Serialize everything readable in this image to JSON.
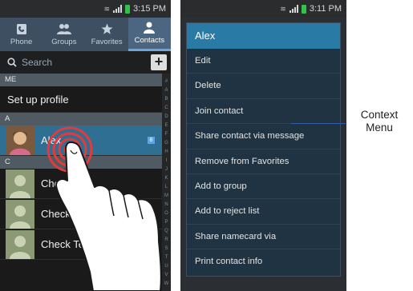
{
  "phone1": {
    "status": {
      "time": "3:15 PM"
    },
    "tabs": [
      {
        "label": "Phone",
        "icon": "phone-icon"
      },
      {
        "label": "Groups",
        "icon": "groups-icon"
      },
      {
        "label": "Favorites",
        "icon": "star-icon"
      },
      {
        "label": "Contacts",
        "icon": "person-icon",
        "active": true
      }
    ],
    "search": {
      "placeholder": "Search",
      "add_label": "+"
    },
    "sections": {
      "me": "ME",
      "profile": "Set up profile",
      "a": "A",
      "c": "C"
    },
    "contacts": [
      {
        "name": "Alex",
        "section": "A",
        "selected": true,
        "badge": "8"
      },
      {
        "name": "Check L",
        "section": "C"
      },
      {
        "name": "Check I",
        "section": "C"
      },
      {
        "name": "Check Te",
        "section": "C"
      }
    ],
    "index_letters": [
      "#",
      "A",
      "B",
      "C",
      "D",
      "E",
      "F",
      "G",
      "H",
      "I",
      "J",
      "K",
      "L",
      "M",
      "N",
      "O",
      "P",
      "Q",
      "R",
      "S",
      "T",
      "U",
      "V",
      "W"
    ]
  },
  "phone2": {
    "status": {
      "time": "3:11 PM"
    },
    "menu": {
      "title": "Alex",
      "items": [
        "Edit",
        "Delete",
        "Join contact",
        "Share contact via message",
        "Remove from Favorites",
        "Add to group",
        "Add to reject list",
        "Share namecard via",
        "Print contact info"
      ]
    }
  },
  "callout": {
    "line1": "Context",
    "line2": "Menu"
  },
  "colors": {
    "accent": "#2a7aa6",
    "selected_row": "#2e6f93",
    "tab_bar": "#3d4f61",
    "touch_ring": "#e53a3a"
  }
}
